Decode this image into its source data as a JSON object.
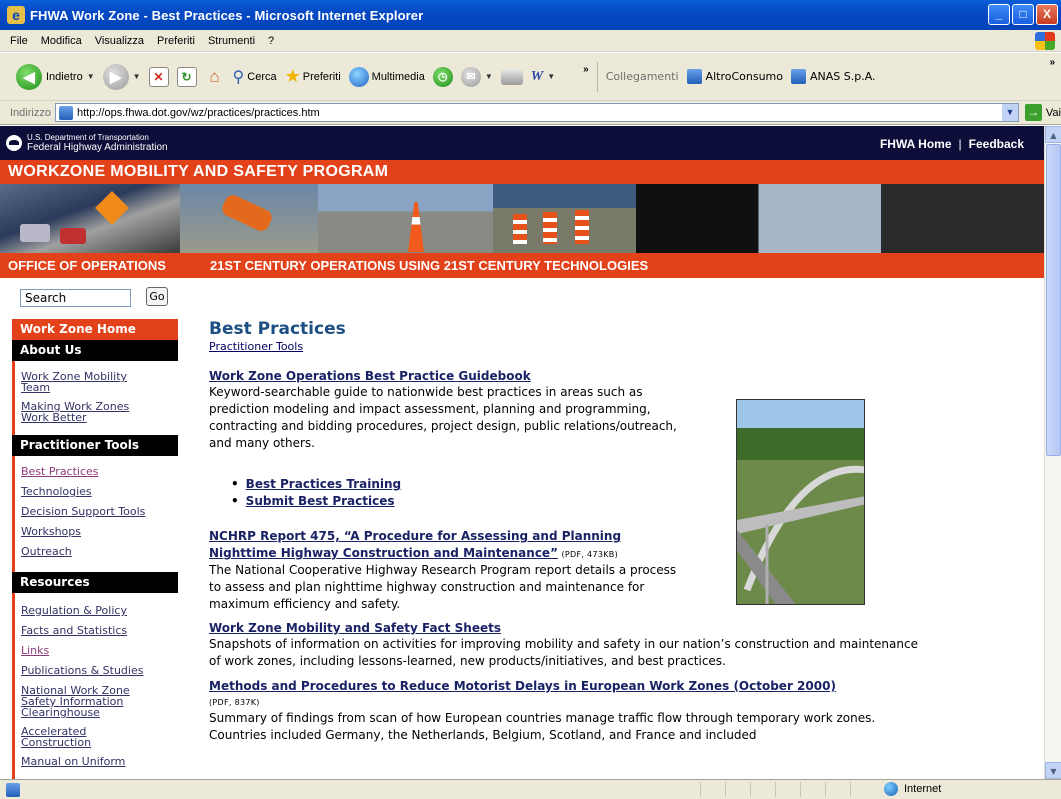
{
  "window": {
    "title": "FHWA Work Zone - Best Practices - Microsoft Internet Explorer",
    "buttons": [
      "_",
      "□",
      "X"
    ]
  },
  "menu": [
    "File",
    "Modifica",
    "Visualizza",
    "Preferiti",
    "Strumenti",
    "?"
  ],
  "toolbar": {
    "back": "Indietro",
    "search": "Cerca",
    "favorites": "Preferiti",
    "media": "Multimedia",
    "links_label": "Collegamenti",
    "links": [
      "AltroConsumo",
      "ANAS S.p.A."
    ]
  },
  "address": {
    "label": "Indirizzo",
    "url": "http://ops.fhwa.dot.gov/wz/practices/practices.htm",
    "go": "Vai"
  },
  "header": {
    "dot_line1": "U.S. Department of Transportation",
    "dot_line2": "Federal Highway Administration",
    "home_link": "FHWA Home",
    "feedback_link": "Feedback",
    "program": "WORKZONE MOBILITY AND SAFETY PROGRAM",
    "ops_left": "OFFICE OF OPERATIONS",
    "ops_right": "21ST CENTURY OPERATIONS USING 21ST CENTURY TECHNOLOGIES"
  },
  "search": {
    "value": "Search",
    "button": "Go"
  },
  "nav": {
    "home": "Work Zone Home",
    "about_heading": "About Us",
    "about": [
      "Work Zone Mobility Team",
      "Making Work Zones Work Better"
    ],
    "tools_heading": "Practitioner Tools",
    "tools": [
      "Best Practices",
      "Technologies",
      "Decision Support Tools",
      "Workshops",
      "Outreach"
    ],
    "resources_heading": "Resources",
    "resources": [
      "Regulation & Policy",
      "Facts and Statistics",
      "Links",
      "Publications & Studies",
      "National Work Zone Safety Information Clearinghouse",
      "Accelerated Construction",
      "Manual on Uniform"
    ]
  },
  "main": {
    "title": "Best Practices",
    "breadcrumb": "Practitioner Tools",
    "s1_link": "Work Zone Operations Best Practice Guidebook",
    "s1_text": "Keyword-searchable guide to nationwide best practices in areas such as prediction modeling and impact assessment, planning and programming, contracting and bidding procedures, project design, public relations/outreach, and many others.",
    "bullets": [
      "Best Practices Training",
      "Submit Best Practices"
    ],
    "s2_link": "NCHRP Report 475, “A Procedure for Assessing and Planning Nighttime Highway Construction and Maintenance”",
    "s2_note": "(PDF, 473KB)",
    "s2_text": "The National Cooperative Highway Research Program report details a process to assess and plan nighttime highway construction and maintenance for maximum efficiency and safety.",
    "s3_link": "Work Zone Mobility and Safety Fact Sheets",
    "s3_text": "Snapshots of information on activities for improving mobility and safety in our nation’s construction and maintenance of work zones, including lessons-learned, new products/initiatives, and best practices.",
    "s4_link": "Methods and Procedures to Reduce Motorist Delays in European Work Zones (October 2000)",
    "s4_note": "(PDF, 837K)",
    "s4_text": "Summary of findings from scan of how European countries manage traffic flow through temporary work zones. Countries included Germany, the Netherlands, Belgium, Scotland, and France and included"
  },
  "status": {
    "zone": "Internet"
  },
  "colors": {
    "orange": "#e2411a",
    "navy": "#0d0d3a",
    "link": "#1a2266",
    "title": "#1d4f84"
  }
}
